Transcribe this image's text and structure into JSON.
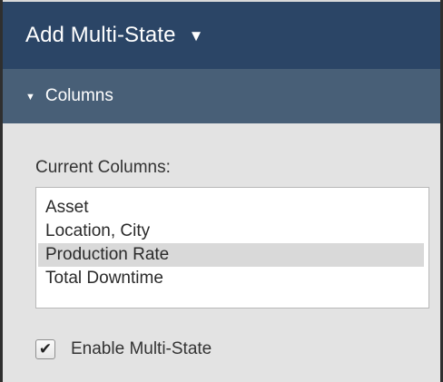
{
  "header": {
    "title": "Add Multi-State",
    "caret_icon": "caret-down-icon",
    "background_color": "#2b4566"
  },
  "section": {
    "title": "Columns",
    "expanded": true,
    "caret_icon": "caret-down-small-icon",
    "background_color": "#485f77"
  },
  "current_columns": {
    "label": "Current Columns:",
    "items": [
      {
        "label": "Asset",
        "selected": false
      },
      {
        "label": "Location, City",
        "selected": false
      },
      {
        "label": "Production Rate",
        "selected": true
      },
      {
        "label": "Total Downtime",
        "selected": false
      }
    ]
  },
  "enable_multi_state": {
    "label": "Enable Multi-State",
    "checked": true,
    "check_icon": "checkmark-icon"
  }
}
